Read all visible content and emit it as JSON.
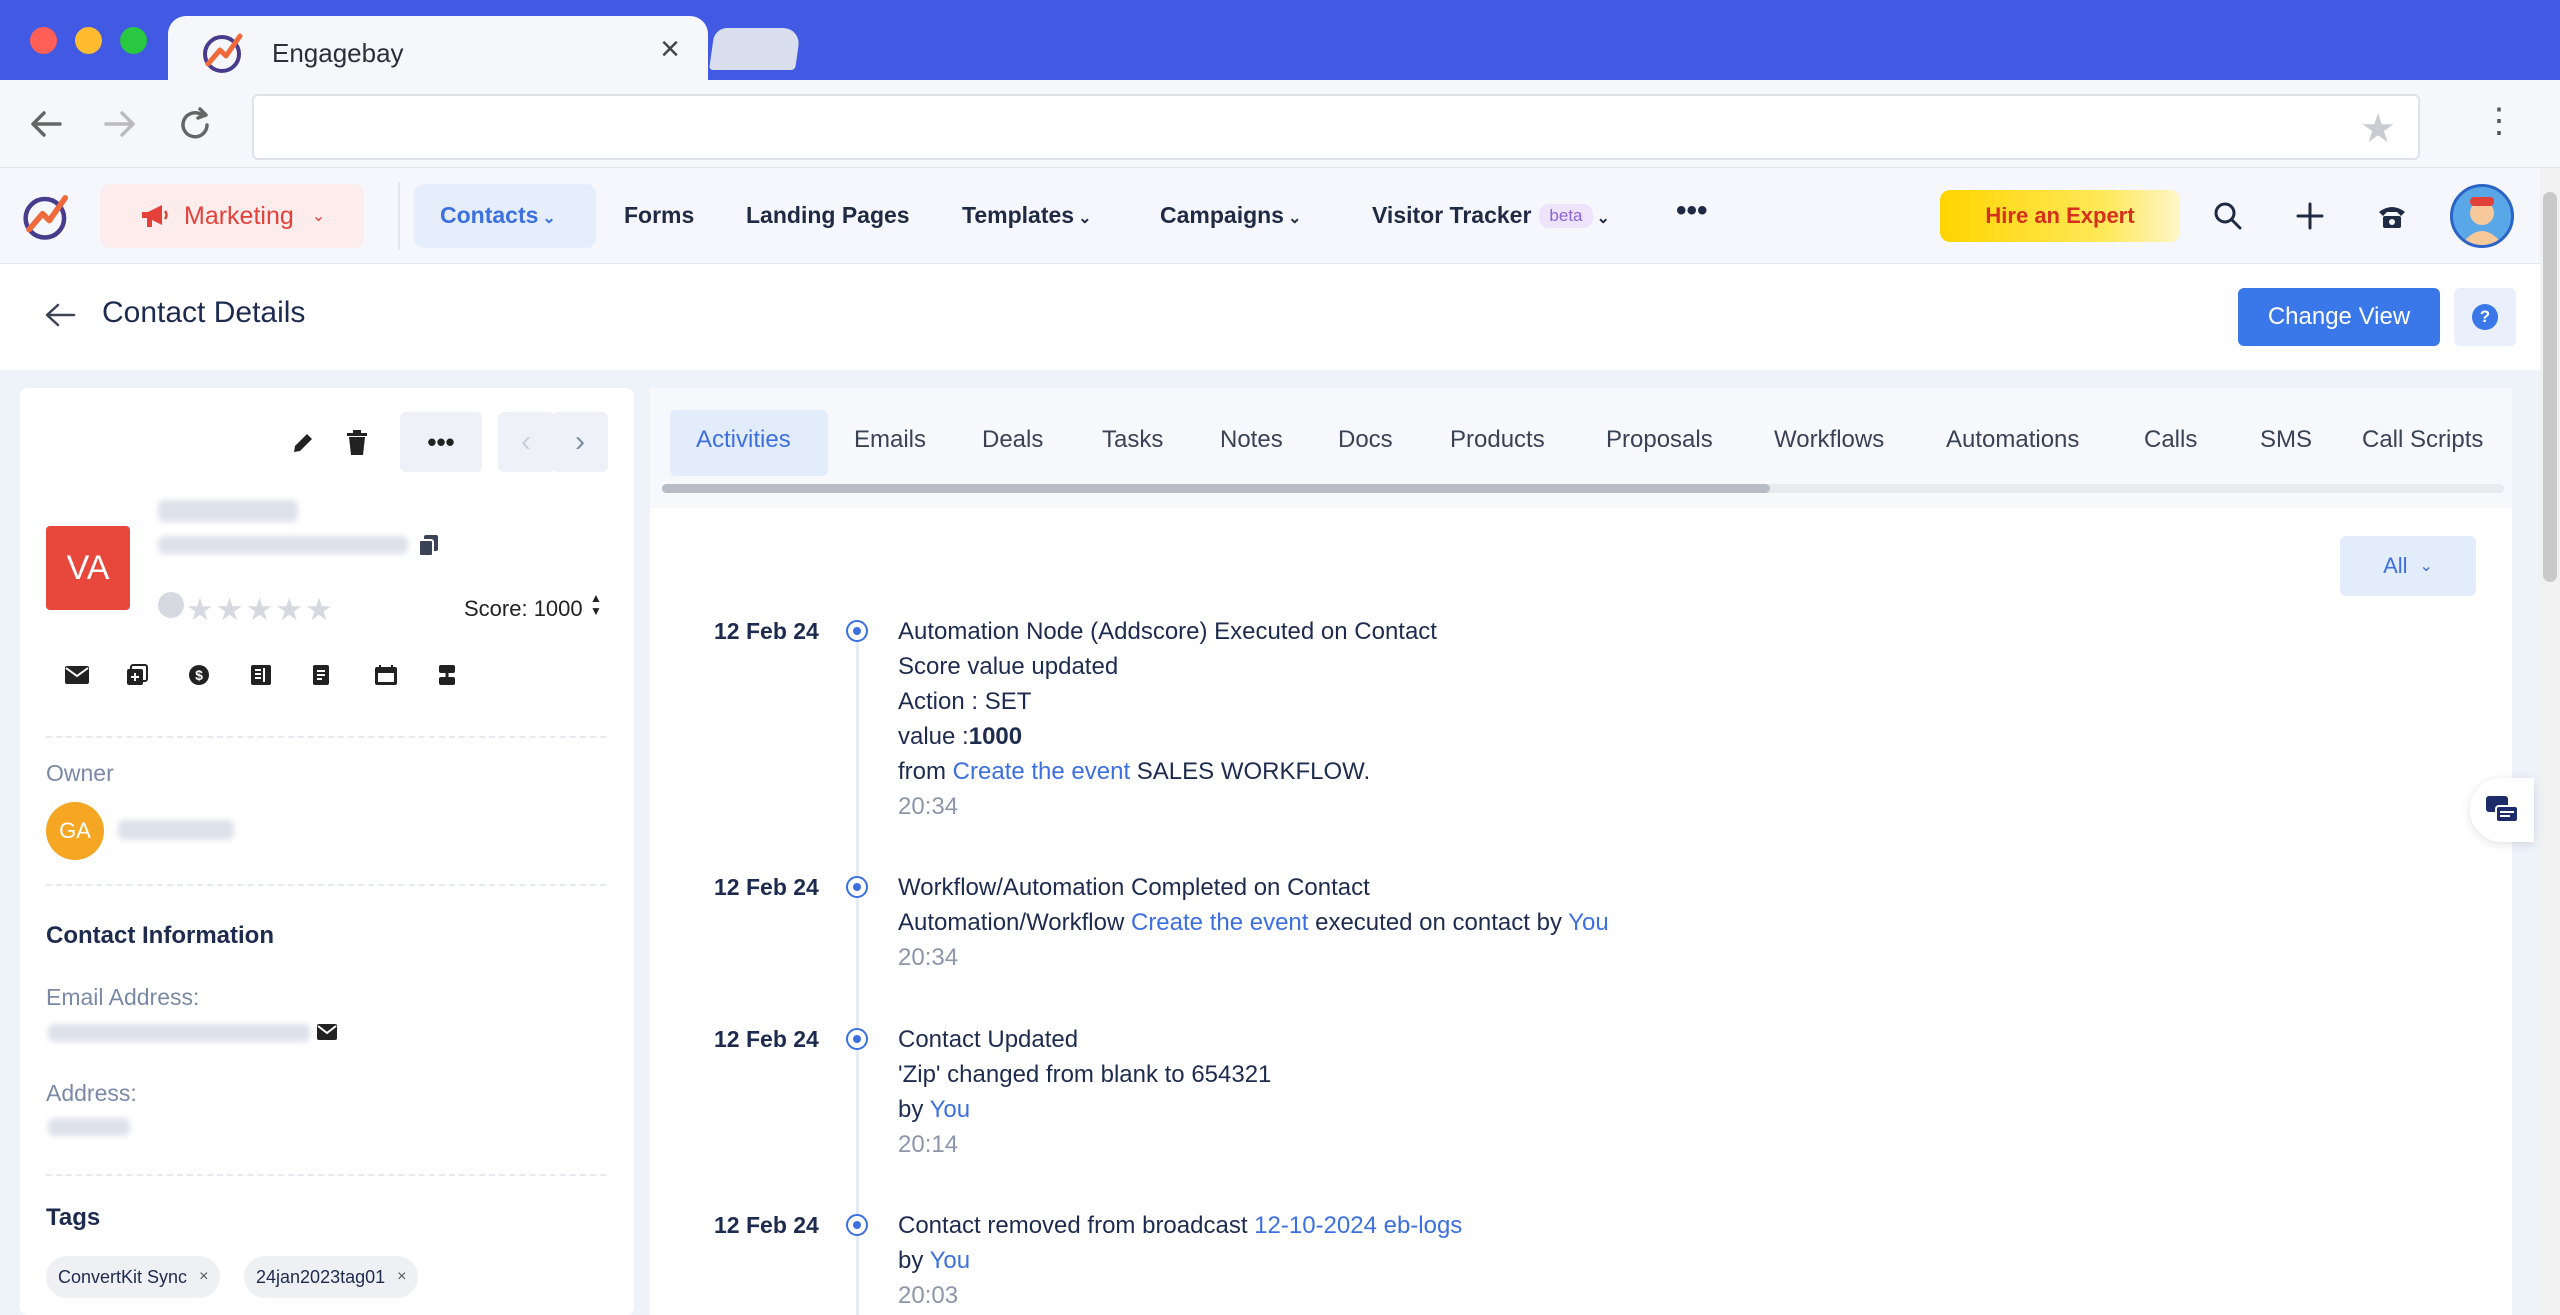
{
  "browser": {
    "tab_title": "Engagebay",
    "tab_close": "×"
  },
  "header": {
    "module": "Marketing",
    "nav": {
      "contacts": "Contacts",
      "forms": "Forms",
      "landing_pages": "Landing Pages",
      "templates": "Templates",
      "campaigns": "Campaigns",
      "visitor_tracker": "Visitor Tracker",
      "beta": "beta",
      "more": "•••"
    },
    "hire_expert": "Hire an Expert"
  },
  "page": {
    "title": "Contact Details",
    "change_view": "Change View",
    "help": "?"
  },
  "contact": {
    "initials": "VA",
    "score_label": "Score: 1000",
    "stars": "★★★★★",
    "rating": 0,
    "owner_label": "Owner",
    "owner_initials": "GA",
    "contact_info_title": "Contact Information",
    "email_label": "Email Address:",
    "address_label": "Address:",
    "tags_title": "Tags",
    "tags": [
      "ConvertKit Sync",
      "24jan2023tag01"
    ]
  },
  "tabs": [
    "Activities",
    "Emails",
    "Deals",
    "Tasks",
    "Notes",
    "Docs",
    "Products",
    "Proposals",
    "Workflows",
    "Automations",
    "Calls",
    "SMS",
    "Call Scripts"
  ],
  "filter": {
    "label": "All"
  },
  "activities": [
    {
      "date": "12 Feb 24",
      "line1": "Automation Node (Addscore) Executed on Contact",
      "line2": "Score value updated",
      "line3": "Action : SET",
      "line4_prefix": "value :",
      "line4_value": "1000",
      "line5_prefix": "from ",
      "line5_link": "Create the event",
      "line5_suffix": " SALES WORKFLOW.",
      "time": "20:34"
    },
    {
      "date": "12 Feb 24",
      "line1": "Workflow/Automation Completed on Contact",
      "line2_prefix": "Automation/Workflow ",
      "line2_link": "Create the event",
      "line2_middle": " executed on contact by ",
      "line2_link2": "You",
      "time": "20:34"
    },
    {
      "date": "12 Feb 24",
      "line1": "Contact Updated",
      "line2": "'Zip' changed from blank to 654321",
      "line3_prefix": "by ",
      "line3_link": "You",
      "time": "20:14"
    },
    {
      "date": "12 Feb 24",
      "line1_prefix": "Contact removed from broadcast ",
      "line1_link": "12-10-2024 eb-logs",
      "line2_prefix": "by ",
      "line2_link": "You",
      "time": "20:03"
    }
  ],
  "colors": {
    "browser_bar": "#4159e3",
    "accent_blue": "#3a78ea",
    "marketing_red": "#e3413a",
    "avatar_red": "#e8473c",
    "owner_orange": "#f5a623",
    "hire_yellow": "#ffd500"
  },
  "icons": [
    "back-icon",
    "forward-icon",
    "reload-icon",
    "star-icon",
    "menu-icon",
    "megaphone-icon",
    "search-icon",
    "plus-icon",
    "phone-icon",
    "edit-icon",
    "delete-icon",
    "copy-icon",
    "email-icon",
    "add-deal-icon",
    "dollar-icon",
    "notes-icon",
    "document-icon",
    "calendar-icon",
    "sequence-icon",
    "chat-icon"
  ]
}
